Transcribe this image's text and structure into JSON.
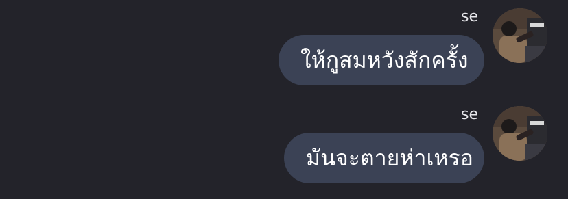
{
  "messages": [
    {
      "sender": "se",
      "text": "ให้กูสมหวังสักครั้ง",
      "avatar_icon": "profile-photo"
    },
    {
      "sender": "se",
      "text": "มันจะตายห่าเหรอ",
      "avatar_icon": "profile-photo"
    }
  ],
  "colors": {
    "background": "#23232a",
    "bubble": "#3b4255",
    "text": "#ffffff",
    "sender": "#e8e8ec"
  }
}
